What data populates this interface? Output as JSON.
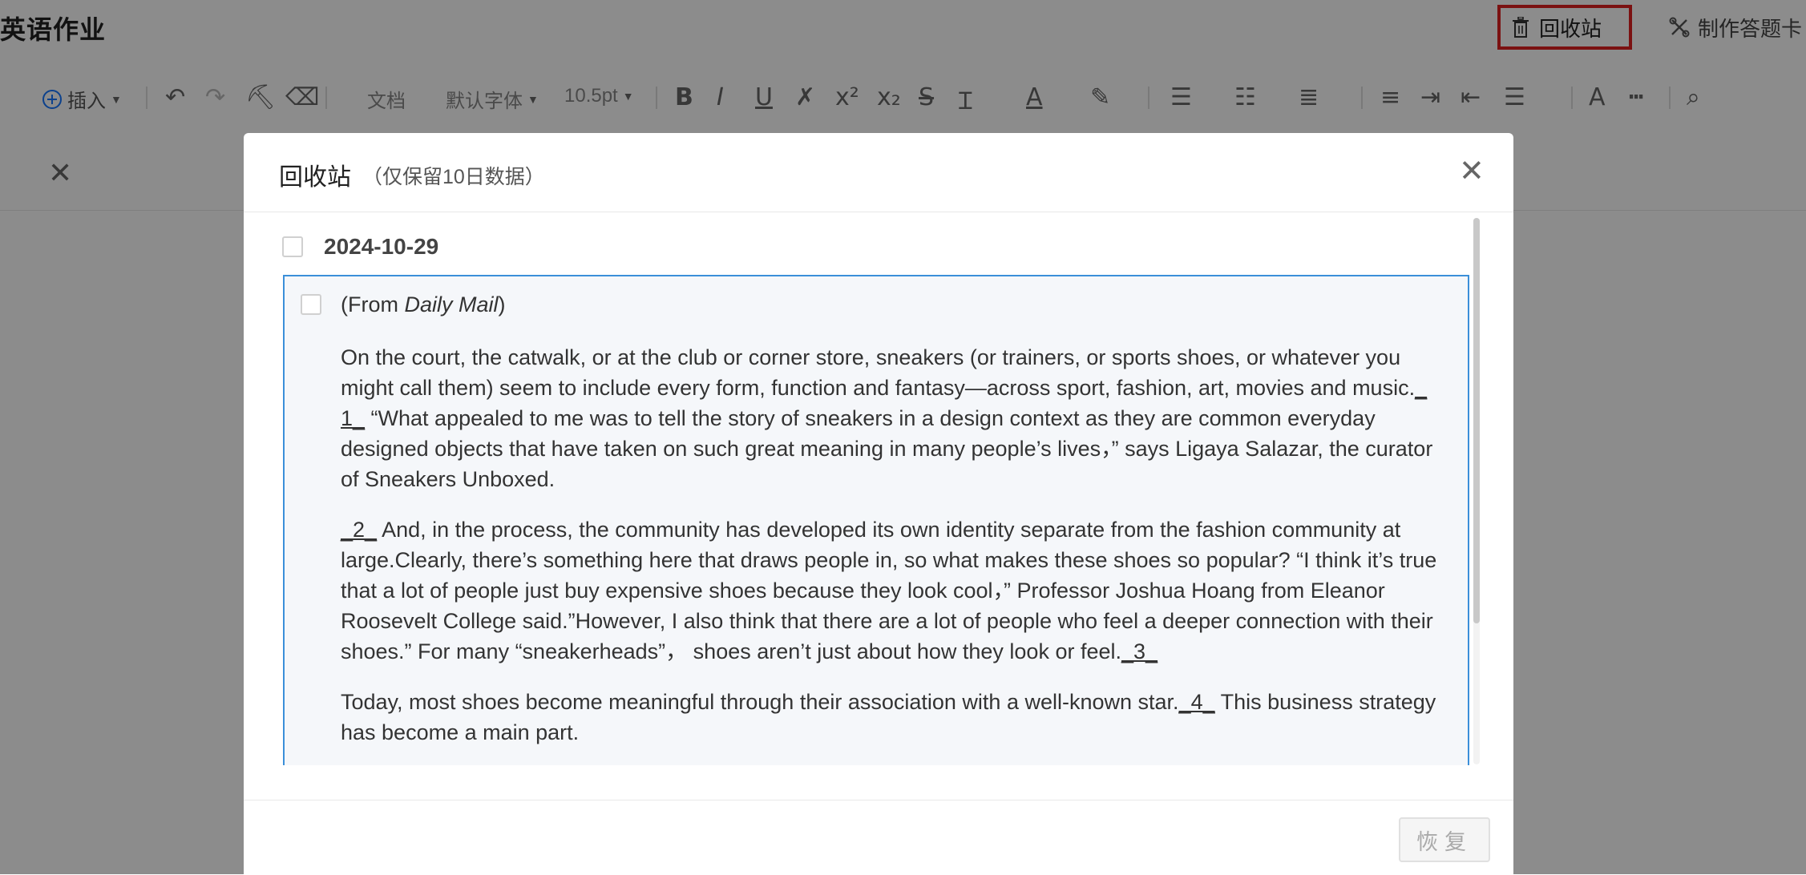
{
  "app": {
    "title": "英语作业"
  },
  "header": {
    "recycle_label": "回收站",
    "answer_card_label": "制作答题卡"
  },
  "toolbar": {
    "insert_label": "插入",
    "doc_label": "文档",
    "font_label": "默认字体",
    "size_label": "10.5pt"
  },
  "modal": {
    "title": "回收站",
    "subtitle": "（仅保留10日数据）",
    "date": "2024-10-29",
    "item": {
      "source_prefix": "(From ",
      "source_name": "Daily Mail",
      "source_suffix": ")",
      "p1_a": "On the court, the catwalk, or at the club or corner store, sneakers (or trainers, or sports shoes, or whatever you might call them) seem to include every form, function and fantasy—across sport, fashion, art, movies and music.",
      "p1_blank": "_ 1_",
      "p1_b": " “What appealed to me was to tell the story of sneakers in a design context as they are common everyday designed objects that have taken on such great meaning in many people’s lives，” says Ligaya Salazar, the curator of Sneakers Unboxed.",
      "p2_blank": "_2_",
      "p2_a": " And, in the process, the community has developed its own identity separate from the fashion community at large.Clearly, there’s something here that draws people in, so what makes these shoes so popular? “I think it’s true that a lot of people just buy expensive shoes because they look cool，” Professor Joshua Hoang from Eleanor Roosevelt College said.”However, I also think that there are a lot of people who feel a deeper connection with their shoes.” For many “sneakerheads”， shoes aren’t just about how they look or feel.",
      "p2_blank2": "_3_",
      "p3_a": "Today, most shoes become meaningful through their association with a well-known star.",
      "p3_blank": "_4_",
      "p3_b": " This business strategy has become a main part."
    },
    "restore_label": "恢复"
  }
}
